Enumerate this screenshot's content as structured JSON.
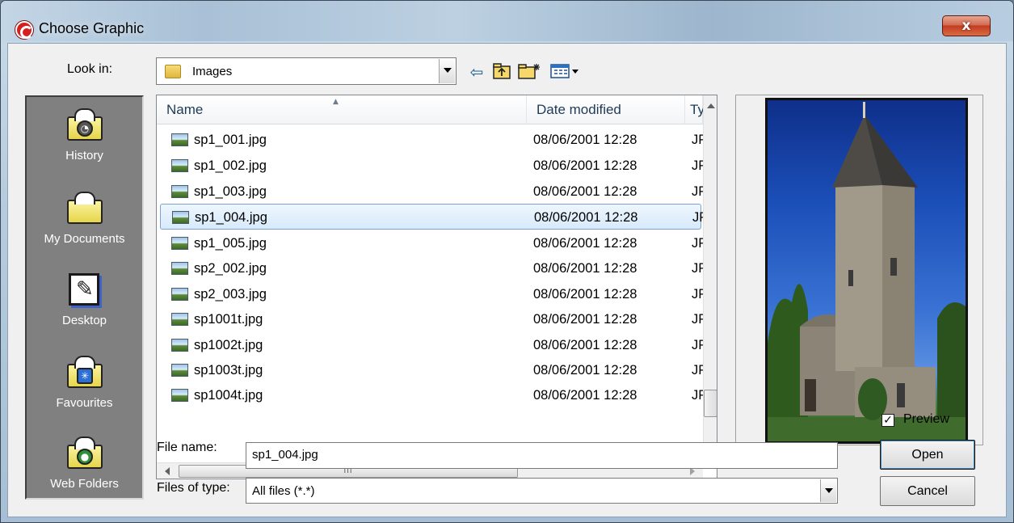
{
  "window": {
    "title": "Choose Graphic",
    "close_glyph": "x"
  },
  "toolbar": {
    "look_in_label": "Look in:",
    "look_in_value": "Images",
    "icons": [
      "back-arrow-icon",
      "up-folder-icon",
      "new-folder-icon",
      "view-menu-icon"
    ]
  },
  "places": [
    {
      "label": "History",
      "icon": "history-folder-icon"
    },
    {
      "label": "My Documents",
      "icon": "my-documents-folder-icon"
    },
    {
      "label": "Desktop",
      "icon": "desktop-icon"
    },
    {
      "label": "Favourites",
      "icon": "favourites-folder-icon"
    },
    {
      "label": "Web Folders",
      "icon": "web-folders-icon"
    }
  ],
  "columns": {
    "name": "Name",
    "date": "Date modified",
    "type": "Ty"
  },
  "files": [
    {
      "name": "sp1_001.jpg",
      "date": "08/06/2001 12:28",
      "type": "JPI"
    },
    {
      "name": "sp1_002.jpg",
      "date": "08/06/2001 12:28",
      "type": "JPI"
    },
    {
      "name": "sp1_003.jpg",
      "date": "08/06/2001 12:28",
      "type": "JPI"
    },
    {
      "name": "sp1_004.jpg",
      "date": "08/06/2001 12:28",
      "type": "JPI",
      "selected": true
    },
    {
      "name": "sp1_005.jpg",
      "date": "08/06/2001 12:28",
      "type": "JPI"
    },
    {
      "name": "sp2_002.jpg",
      "date": "08/06/2001 12:28",
      "type": "JPI"
    },
    {
      "name": "sp2_003.jpg",
      "date": "08/06/2001 12:28",
      "type": "JPI"
    },
    {
      "name": "sp1001t.jpg",
      "date": "08/06/2001 12:28",
      "type": "JPI"
    },
    {
      "name": "sp1002t.jpg",
      "date": "08/06/2001 12:28",
      "type": "JPI"
    },
    {
      "name": "sp1003t.jpg",
      "date": "08/06/2001 12:28",
      "type": "JPI"
    },
    {
      "name": "sp1004t.jpg",
      "date": "08/06/2001 12:28",
      "type": "JPI"
    }
  ],
  "hscroll_thumb_grip": "III",
  "preview": {
    "label": "Preview",
    "checked": true,
    "check_glyph": "✓"
  },
  "fields": {
    "file_name_label": "File name:",
    "file_name_value": "sp1_004.jpg",
    "file_type_label": "Files of type:",
    "file_type_value": "All files (*.*)"
  },
  "buttons": {
    "open": "Open",
    "cancel": "Cancel"
  },
  "colors": {
    "selection_border": "#7da2ce",
    "places_bg": "#808080",
    "close_red": "#c23d20"
  }
}
